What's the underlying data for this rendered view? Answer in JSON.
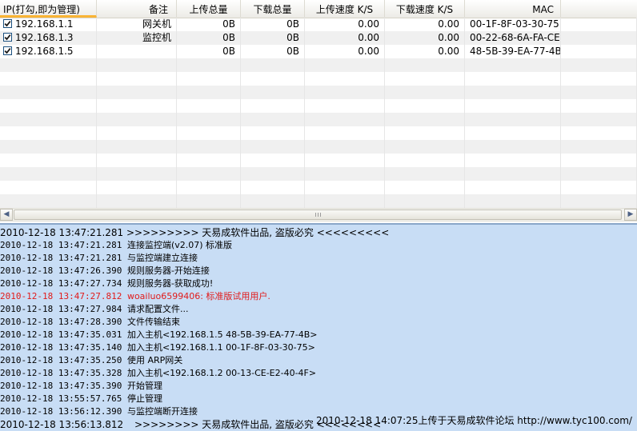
{
  "table": {
    "headers": [
      "IP(打勾,即为管理)",
      "备注",
      "上传总量",
      "下载总量",
      "上传速度 K/S",
      "下载速度 K/S",
      "MAC"
    ],
    "rows": [
      {
        "checked": true,
        "ip": "192.168.1.1",
        "note": "网关机",
        "up_total": "0B",
        "down_total": "0B",
        "up_speed": "0.00",
        "down_speed": "0.00",
        "mac": "00-1F-8F-03-30-75"
      },
      {
        "checked": true,
        "ip": "192.168.1.3",
        "note": "监控机",
        "up_total": "0B",
        "down_total": "0B",
        "up_speed": "0.00",
        "down_speed": "0.00",
        "mac": "00-22-68-6A-FA-CE"
      },
      {
        "checked": true,
        "ip": "192.168.1.5",
        "note": "",
        "up_total": "0B",
        "down_total": "0B",
        "up_speed": "0.00",
        "down_speed": "0.00",
        "mac": "48-5B-39-EA-77-4B"
      }
    ]
  },
  "scrollbar": {
    "left_icon": "left-arrow-icon",
    "right_icon": "right-arrow-icon"
  },
  "log": {
    "header": {
      "time": "2010-12-18 13:47:21.281",
      "msg": ">>>>>>>>>  天易成软件出品, 盗版必究   <<<<<<<<<"
    },
    "entries": [
      {
        "time": "2010-12-18 13:47:21.281",
        "msg": "连接监控端(v2.07) 标准版",
        "red": false
      },
      {
        "time": "2010-12-18 13:47:21.281",
        "msg": "与监控端建立连接",
        "red": false
      },
      {
        "time": "2010-12-18 13:47:26.390",
        "msg": "规则服务器-开始连接",
        "red": false
      },
      {
        "time": "2010-12-18 13:47:27.734",
        "msg": "规则服务器-获取成功!",
        "red": false
      },
      {
        "time": "2010-12-18 13:47:27.812",
        "msg": "woailuo6599406: 标准版试用用户.",
        "red": true
      },
      {
        "time": "2010-12-18 13:47:27.984",
        "msg": "请求配置文件...",
        "red": false
      },
      {
        "time": "2010-12-18 13:47:28.390",
        "msg": "文件传输结束",
        "red": false
      },
      {
        "time": "2010-12-18 13:47:35.031",
        "msg": "加入主机<192.168.1.5 48-5B-39-EA-77-4B>",
        "red": false
      },
      {
        "time": "2010-12-18 13:47:35.140",
        "msg": "加入主机<192.168.1.1 00-1F-8F-03-30-75>",
        "red": false
      },
      {
        "time": "2010-12-18 13:47:35.250",
        "msg": "使用  ARP网关",
        "red": false
      },
      {
        "time": "2010-12-18 13:47:35.328",
        "msg": "加入主机<192.168.1.2 00-13-CE-E2-40-4F>",
        "red": false
      },
      {
        "time": "2010-12-18 13:47:35.390",
        "msg": "开始管理",
        "red": false
      },
      {
        "time": "2010-12-18 13:55:57.765",
        "msg": "停止管理",
        "red": false
      },
      {
        "time": "2010-12-18 13:56:12.390",
        "msg": "与监控端断开连接",
        "red": false
      },
      {
        "time": "2010-12-18 13:56:13.812",
        "msg": ">>>>>>>>  天易成软件出品, 盗版必究    <<<<<<<<",
        "red": false
      }
    ]
  },
  "watermark": "2010-12-18 14:07:25上传于天易成软件论坛 http://www.tyc100.com/",
  "colors": {
    "log_bg": "#c8ddf5",
    "header_accent": "#f9b434",
    "error_text": "#e11b1b"
  }
}
